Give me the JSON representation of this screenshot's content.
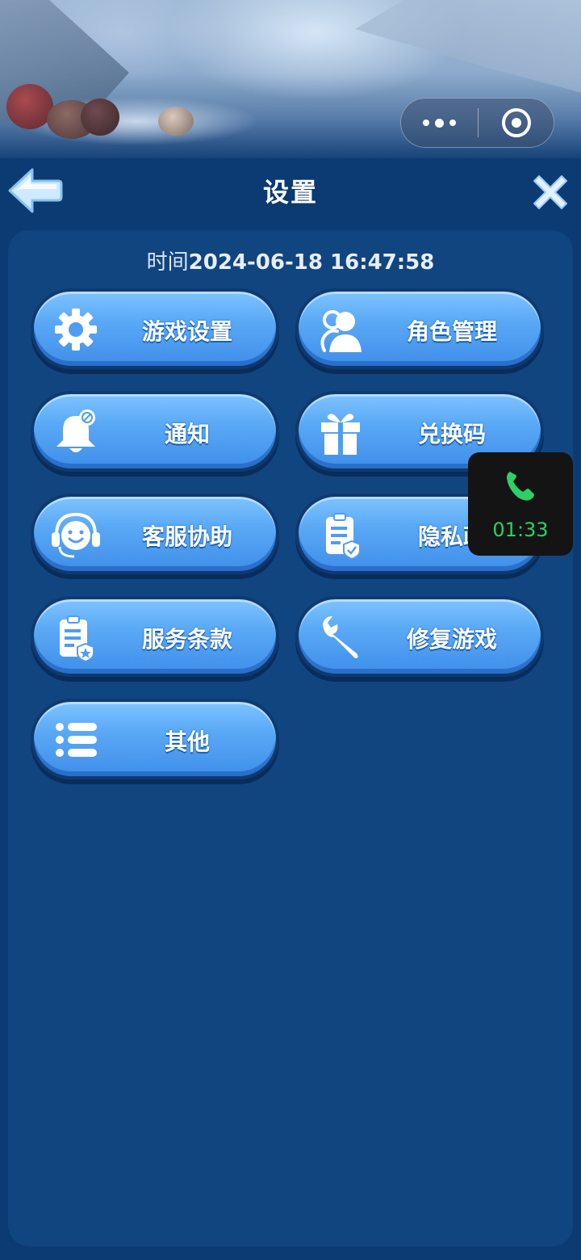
{
  "header": {
    "title": "设置"
  },
  "panel": {
    "time_label": "时间",
    "time_value": "2024-06-18 16:47:58"
  },
  "menu": [
    {
      "label": "游戏设置",
      "icon": "gear-icon"
    },
    {
      "label": "角色管理",
      "icon": "person-icon"
    },
    {
      "label": "通知",
      "icon": "bell-icon"
    },
    {
      "label": "兑换码",
      "icon": "gift-icon"
    },
    {
      "label": "客服协助",
      "icon": "headset-icon"
    },
    {
      "label": "隐私政",
      "icon": "clipboard-shield-icon"
    },
    {
      "label": "服务条款",
      "icon": "clipboard-star-icon"
    },
    {
      "label": "修复游戏",
      "icon": "wrench-icon"
    },
    {
      "label": "其他",
      "icon": "list-icon"
    }
  ],
  "call": {
    "duration": "01:33",
    "color": "#2fcf68"
  },
  "colors": {
    "background": "#0c3a72",
    "panel": "#11457f",
    "button": "#5aa9f6"
  }
}
